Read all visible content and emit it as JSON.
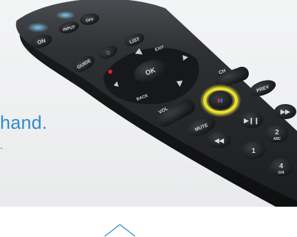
{
  "headline": "hand.",
  "subline": ".",
  "remote": {
    "color": "#2a2c2f",
    "voice_highlight_color": "#e8e02a",
    "labels": {
      "on": "ON",
      "input": "INPUT",
      "off": "OFF",
      "guide": "GUIDE",
      "home": "⌂",
      "list": "LIST",
      "exit": "EXIT",
      "ok": "OK",
      "back": "BACK",
      "info": "i",
      "vol": "VOL",
      "ch": "CH",
      "mute": "MUTE",
      "prev": "PREV",
      "num1": "1",
      "num2": "2",
      "num2_sub": "ABC",
      "num4": "4",
      "num4_sub": "GHI"
    }
  },
  "accent_color": "#2f8ccb",
  "chevron_icon": "chevron-up-icon"
}
